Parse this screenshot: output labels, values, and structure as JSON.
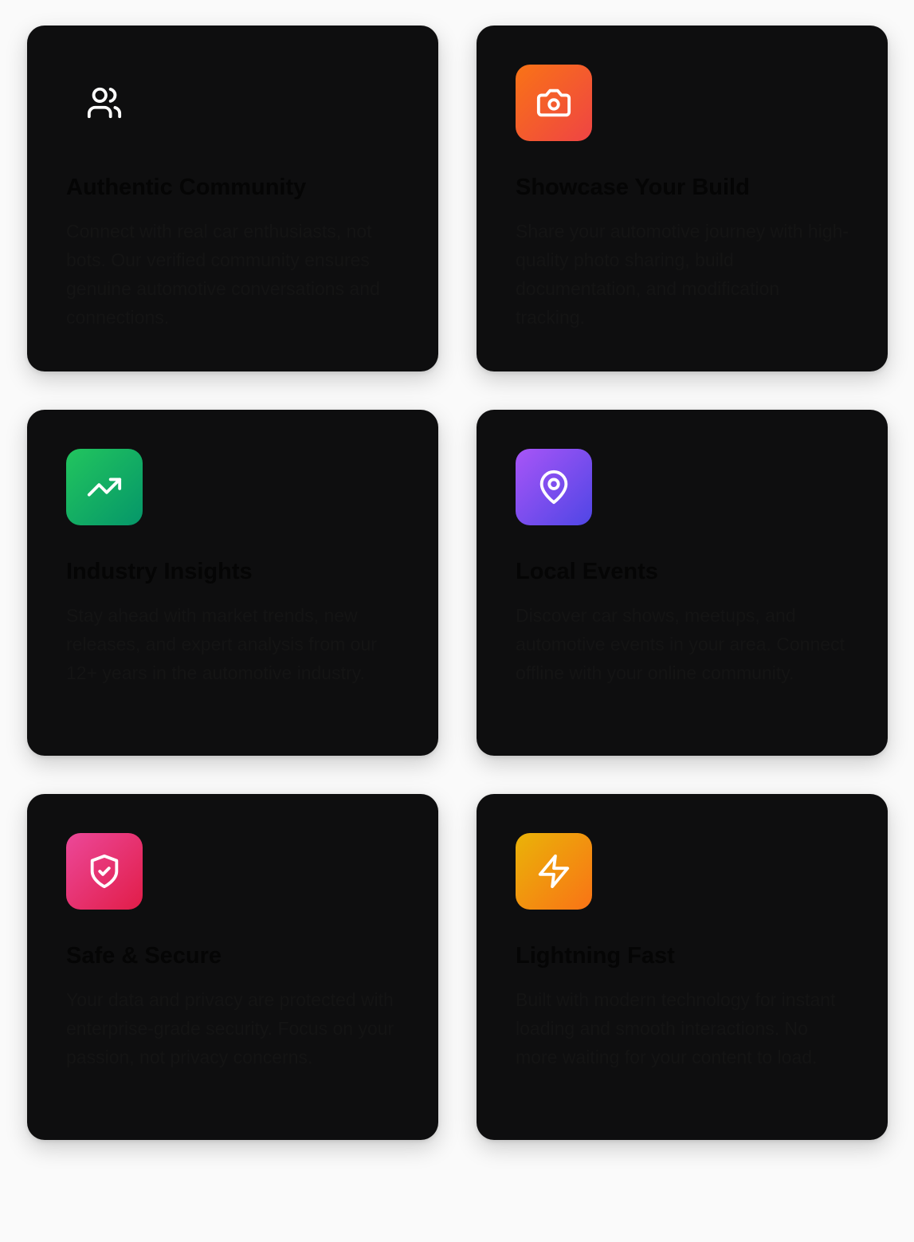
{
  "features": [
    {
      "title": "Authentic Community",
      "description": "Connect with real car enthusiasts, not bots. Our verified community ensures genuine automotive conversations and connections.",
      "icon": "users-icon",
      "gradient": [
        "#0e0e0f",
        "#0e0e0f"
      ]
    },
    {
      "title": "Showcase Your Build",
      "description": "Share your automotive journey with high-quality photo sharing, build documentation, and modification tracking.",
      "icon": "camera-icon",
      "gradient": [
        "#f97316",
        "#ef4444"
      ]
    },
    {
      "title": "Industry Insights",
      "description": "Stay ahead with market trends, new releases, and expert analysis from our 12+ years in the automotive industry.",
      "icon": "trending-up-icon",
      "gradient": [
        "#22c55e",
        "#059669"
      ]
    },
    {
      "title": "Local Events",
      "description": "Discover car shows, meetups, and automotive events in your area. Connect offline with your online community.",
      "icon": "map-pin-icon",
      "gradient": [
        "#a855f7",
        "#4f46e5"
      ]
    },
    {
      "title": "Safe & Secure",
      "description": "Your data and privacy are protected with enterprise-grade security. Focus on your passion, not privacy concerns.",
      "icon": "shield-check-icon",
      "gradient": [
        "#ec4899",
        "#e11d48"
      ]
    },
    {
      "title": "Lightning Fast",
      "description": "Built with modern technology for instant loading and smooth interactions. No more waiting for your content to load.",
      "icon": "zap-icon",
      "gradient": [
        "#eab308",
        "#f97316"
      ]
    }
  ]
}
